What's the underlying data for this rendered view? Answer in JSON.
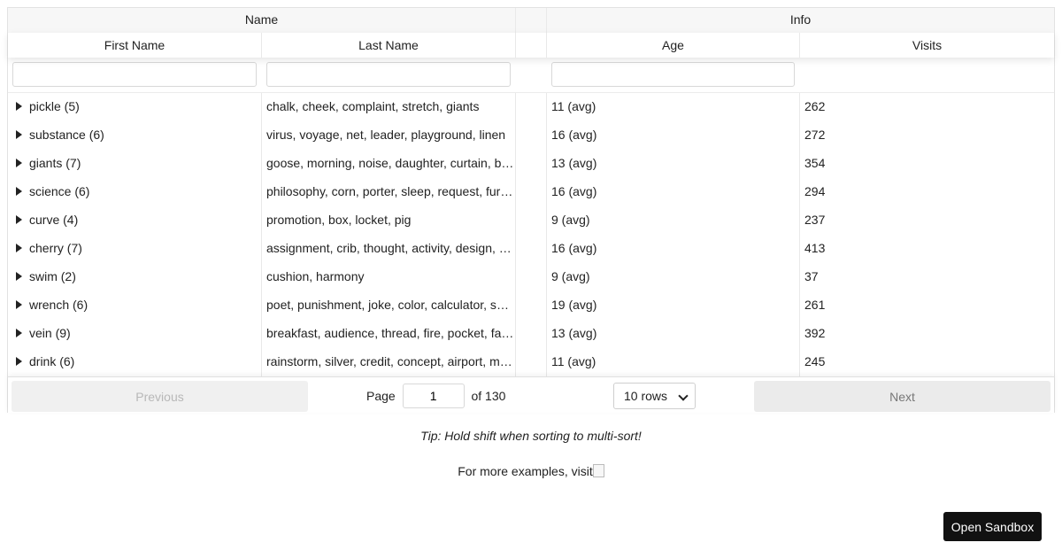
{
  "groups": {
    "name": "Name",
    "info": "Info"
  },
  "headers": {
    "first_name": "First Name",
    "last_name": "Last Name",
    "age": "Age",
    "visits": "Visits"
  },
  "rows": [
    {
      "first": "pickle (5)",
      "last": "chalk, cheek, complaint, stretch, giants",
      "age": "11 (avg)",
      "visits": "262"
    },
    {
      "first": "substance (6)",
      "last": "virus, voyage, net, leader, playground, linen",
      "age": "16 (avg)",
      "visits": "272"
    },
    {
      "first": "giants (7)",
      "last": "goose, morning, noise, daughter, curtain, b…",
      "age": "13 (avg)",
      "visits": "354"
    },
    {
      "first": "science (6)",
      "last": "philosophy, corn, porter, sleep, request, fur…",
      "age": "16 (avg)",
      "visits": "294"
    },
    {
      "first": "curve (4)",
      "last": "promotion, box, locket, pig",
      "age": "9 (avg)",
      "visits": "237"
    },
    {
      "first": "cherry (7)",
      "last": "assignment, crib, thought, activity, design, s…",
      "age": "16 (avg)",
      "visits": "413"
    },
    {
      "first": "swim (2)",
      "last": "cushion, harmony",
      "age": "9 (avg)",
      "visits": "37"
    },
    {
      "first": "wrench (6)",
      "last": "poet, punishment, joke, color, calculator, so…",
      "age": "19 (avg)",
      "visits": "261"
    },
    {
      "first": "vein (9)",
      "last": "breakfast, audience, thread, fire, pocket, fai…",
      "age": "13 (avg)",
      "visits": "392"
    },
    {
      "first": "drink (6)",
      "last": "rainstorm, silver, credit, concept, airport, m…",
      "age": "11 (avg)",
      "visits": "245"
    }
  ],
  "pagination": {
    "previous_label": "Previous",
    "next_label": "Next",
    "page_label": "Page",
    "page_value": "1",
    "of_label": "of 130",
    "rows_selected": "10 rows"
  },
  "tip": "Tip: Hold shift when sorting to multi-sort!",
  "more_examples": "For more examples, visit",
  "sandbox_label": "Open Sandbox"
}
